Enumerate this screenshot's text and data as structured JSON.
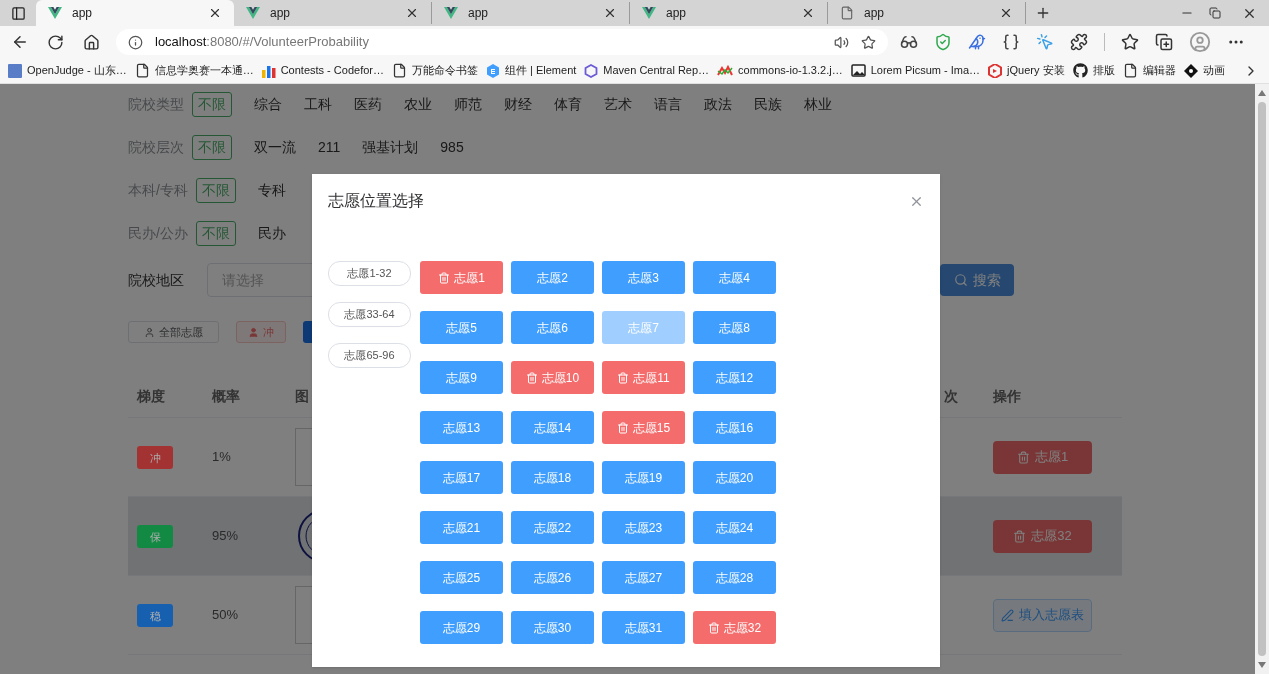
{
  "browser": {
    "tabs": [
      {
        "title": "app",
        "selected": true,
        "kind": "vue"
      },
      {
        "title": "app",
        "selected": false,
        "kind": "vue"
      },
      {
        "title": "app",
        "selected": false,
        "kind": "vue"
      },
      {
        "title": "app",
        "selected": false,
        "kind": "vue"
      },
      {
        "title": "app",
        "selected": false,
        "kind": "page"
      }
    ],
    "address": {
      "host": "localhost",
      "path": ":8080/#/VolunteerProbability"
    },
    "bookmarks": [
      {
        "label": "OpenJudge - 山东…",
        "kind": "poj"
      },
      {
        "label": "信息学奥赛一本通…",
        "kind": "page"
      },
      {
        "label": "Contests - Codefor…",
        "kind": "bars"
      },
      {
        "label": "万能命令书签",
        "kind": "page"
      },
      {
        "label": "组件 | Element",
        "kind": "element"
      },
      {
        "label": "Maven Central Rep…",
        "kind": "hexagon"
      },
      {
        "label": "commons-io-1.3.2.j…",
        "kind": "wave"
      },
      {
        "label": "Lorem Picsum - Ima…",
        "kind": "image"
      },
      {
        "label": "jQuery 安装",
        "kind": "jquery"
      },
      {
        "label": "排版",
        "kind": "github"
      },
      {
        "label": "编辑器",
        "kind": "page"
      },
      {
        "label": "动画",
        "kind": "diamond"
      }
    ]
  },
  "filters": [
    {
      "label": "院校类型",
      "options": [
        {
          "text": "不限",
          "selected": true
        },
        {
          "text": "综合",
          "selected": false
        },
        {
          "text": "工科",
          "selected": false
        },
        {
          "text": "医药",
          "selected": false
        },
        {
          "text": "农业",
          "selected": false
        },
        {
          "text": "师范",
          "selected": false
        },
        {
          "text": "财经",
          "selected": false
        },
        {
          "text": "体育",
          "selected": false
        },
        {
          "text": "艺术",
          "selected": false
        },
        {
          "text": "语言",
          "selected": false
        },
        {
          "text": "政法",
          "selected": false
        },
        {
          "text": "民族",
          "selected": false
        },
        {
          "text": "林业",
          "selected": false
        }
      ]
    },
    {
      "label": "院校层次",
      "options": [
        {
          "text": "不限",
          "selected": true
        },
        {
          "text": "双一流",
          "selected": false
        },
        {
          "text": "211",
          "selected": false
        },
        {
          "text": "强基计划",
          "selected": false
        },
        {
          "text": "985",
          "selected": false
        }
      ]
    },
    {
      "label": "本科/专科",
      "options": [
        {
          "text": "不限",
          "selected": true
        },
        {
          "text": "专科",
          "selected": false
        }
      ]
    },
    {
      "label": "民办/公办",
      "options": [
        {
          "text": "不限",
          "selected": true
        },
        {
          "text": "民办",
          "selected": false
        }
      ]
    }
  ],
  "region": {
    "label": "院校地区",
    "placeholder": "请选择",
    "search": "搜索"
  },
  "actions": [
    {
      "label": "全部志愿",
      "kind": "all"
    },
    {
      "label": "冲",
      "kind": "reach"
    },
    {
      "kind": "primary"
    }
  ],
  "table": {
    "columns_left": [
      "梯度",
      "概率",
      "图"
    ],
    "columns_right": [
      "次",
      "操作"
    ],
    "rows": [
      {
        "tier": "冲",
        "color": "#a33232",
        "probability": "1%",
        "logo": false,
        "hovered": false,
        "action": {
          "label": "志愿1",
          "kind": "delete"
        }
      },
      {
        "tier": "保",
        "color": "#138a44",
        "probability": "95%",
        "logo": true,
        "hovered": true,
        "action": {
          "label": "志愿32",
          "kind": "delete"
        }
      },
      {
        "tier": "稳",
        "color": "#1760b0",
        "probability": "50%",
        "logo": false,
        "hovered": false,
        "action": {
          "label": "填入志愿表",
          "kind": "fill"
        }
      }
    ]
  },
  "dialog": {
    "title": "志愿位置选择",
    "ranges": [
      "志愿1-32",
      "志愿33-64",
      "志愿65-96"
    ],
    "slots": [
      {
        "label": "志愿1",
        "kind": "occupied",
        "disabled": false
      },
      {
        "label": "志愿2",
        "kind": "free",
        "disabled": false
      },
      {
        "label": "志愿3",
        "kind": "free",
        "disabled": false
      },
      {
        "label": "志愿4",
        "kind": "free",
        "disabled": false
      },
      {
        "label": "志愿5",
        "kind": "free",
        "disabled": false
      },
      {
        "label": "志愿6",
        "kind": "free",
        "disabled": false
      },
      {
        "label": "志愿7",
        "kind": "free",
        "disabled": true
      },
      {
        "label": "志愿8",
        "kind": "free",
        "disabled": false
      },
      {
        "label": "志愿9",
        "kind": "free",
        "disabled": false
      },
      {
        "label": "志愿10",
        "kind": "occupied",
        "disabled": false
      },
      {
        "label": "志愿11",
        "kind": "occupied",
        "disabled": false
      },
      {
        "label": "志愿12",
        "kind": "free",
        "disabled": false
      },
      {
        "label": "志愿13",
        "kind": "free",
        "disabled": false
      },
      {
        "label": "志愿14",
        "kind": "free",
        "disabled": false
      },
      {
        "label": "志愿15",
        "kind": "occupied",
        "disabled": false
      },
      {
        "label": "志愿16",
        "kind": "free",
        "disabled": false
      },
      {
        "label": "志愿17",
        "kind": "free",
        "disabled": false
      },
      {
        "label": "志愿18",
        "kind": "free",
        "disabled": false
      },
      {
        "label": "志愿19",
        "kind": "free",
        "disabled": false
      },
      {
        "label": "志愿20",
        "kind": "free",
        "disabled": false
      },
      {
        "label": "志愿21",
        "kind": "free",
        "disabled": false
      },
      {
        "label": "志愿22",
        "kind": "free",
        "disabled": false
      },
      {
        "label": "志愿23",
        "kind": "free",
        "disabled": false
      },
      {
        "label": "志愿24",
        "kind": "free",
        "disabled": false
      },
      {
        "label": "志愿25",
        "kind": "free",
        "disabled": false
      },
      {
        "label": "志愿26",
        "kind": "free",
        "disabled": false
      },
      {
        "label": "志愿27",
        "kind": "free",
        "disabled": false
      },
      {
        "label": "志愿28",
        "kind": "free",
        "disabled": false
      },
      {
        "label": "志愿29",
        "kind": "free",
        "disabled": false
      },
      {
        "label": "志愿30",
        "kind": "free",
        "disabled": false
      },
      {
        "label": "志愿31",
        "kind": "free",
        "disabled": false
      },
      {
        "label": "志愿32",
        "kind": "occupied",
        "disabled": false
      }
    ]
  }
}
